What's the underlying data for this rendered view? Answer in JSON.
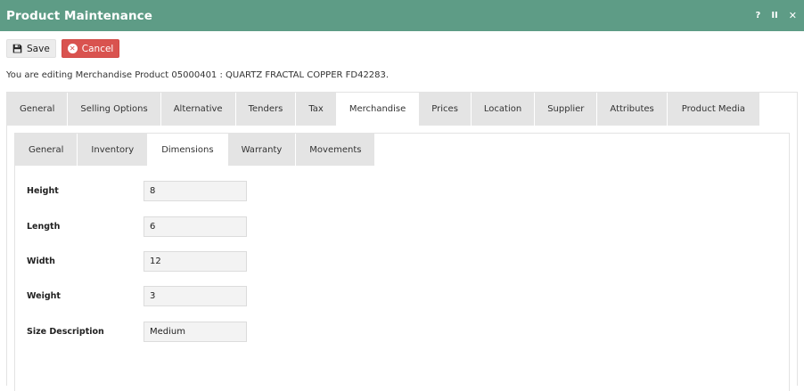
{
  "window": {
    "title": "Product Maintenance",
    "controls": {
      "help": "?",
      "pause": "II",
      "close": "✕"
    }
  },
  "toolbar": {
    "save_label": "Save",
    "cancel_label": "Cancel"
  },
  "info_text": "You are editing Merchandise Product 05000401 : QUARTZ FRACTAL COPPER FD42283.",
  "main_tabs": [
    {
      "label": "General"
    },
    {
      "label": "Selling Options"
    },
    {
      "label": "Alternative"
    },
    {
      "label": "Tenders"
    },
    {
      "label": "Tax"
    },
    {
      "label": "Merchandise"
    },
    {
      "label": "Prices"
    },
    {
      "label": "Location"
    },
    {
      "label": "Supplier"
    },
    {
      "label": "Attributes"
    },
    {
      "label": "Product Media"
    }
  ],
  "main_tabs_active": "Merchandise",
  "sub_tabs": [
    {
      "label": "General"
    },
    {
      "label": "Inventory"
    },
    {
      "label": "Dimensions"
    },
    {
      "label": "Warranty"
    },
    {
      "label": "Movements"
    }
  ],
  "sub_tabs_active": "Dimensions",
  "form": {
    "fields": [
      {
        "label": "Height",
        "value": "8"
      },
      {
        "label": "Length",
        "value": "6"
      },
      {
        "label": "Width",
        "value": "12"
      },
      {
        "label": "Weight",
        "value": "3"
      },
      {
        "label": "Size Description",
        "value": "Medium"
      }
    ]
  },
  "colors": {
    "header": "#5e9c86",
    "cancel": "#d9534f",
    "tab_inactive": "#e4e4e4",
    "tab_active": "#ffffff"
  },
  "icons": {
    "save": "floppy-disk-icon",
    "cancel": "cancel-circle-icon"
  }
}
